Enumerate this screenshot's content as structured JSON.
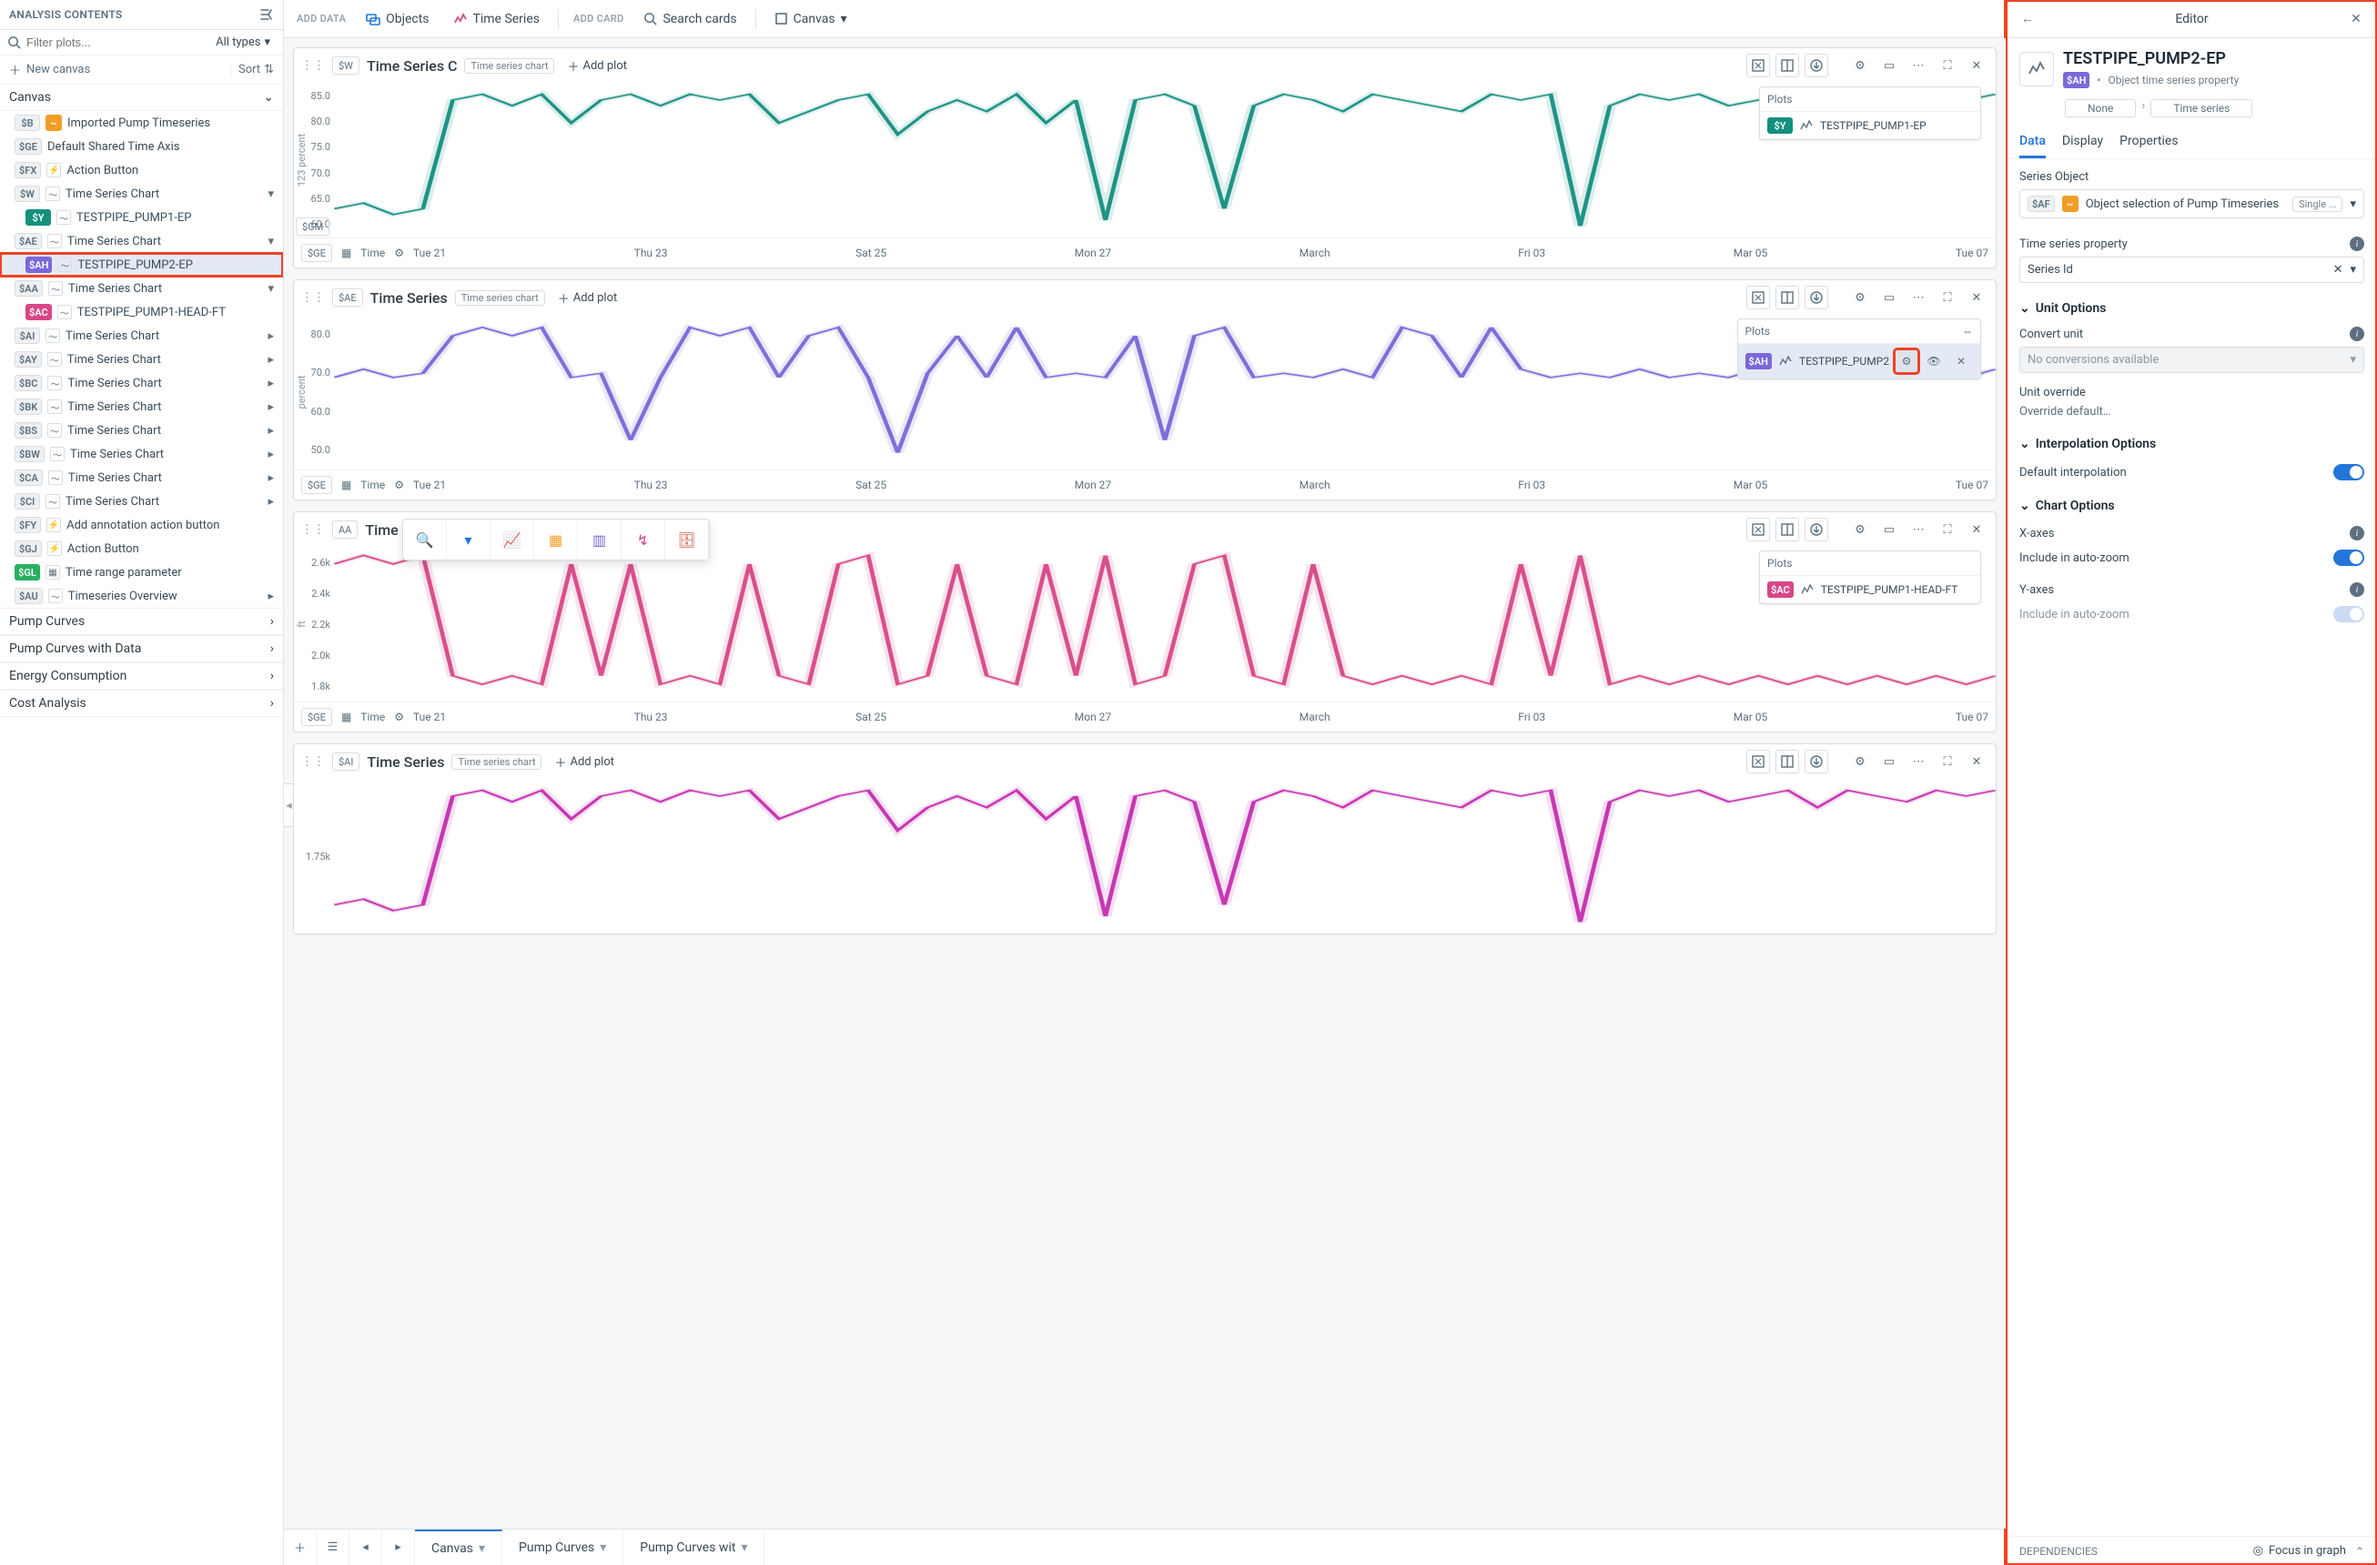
{
  "sidebar": {
    "header": "ANALYSIS CONTENTS",
    "filter_placeholder": "Filter plots...",
    "types_label": "All types",
    "new_canvas": "New canvas",
    "sort": "Sort",
    "canvas_section": "Canvas",
    "items": [
      {
        "tag": "$B",
        "tagStyle": "tag-gray",
        "icon": "orange",
        "label": "Imported Pump Timeseries",
        "chev": ""
      },
      {
        "tag": "$GE",
        "tagStyle": "tag-gray",
        "icon": "",
        "label": "Default Shared Time Axis",
        "chev": ""
      },
      {
        "tag": "$FX",
        "tagStyle": "tag-gray",
        "icon": "fx",
        "label": "Action Button",
        "chev": ""
      },
      {
        "tag": "$W",
        "tagStyle": "tag-gray",
        "icon": "chart",
        "label": "Time Series Chart",
        "chev": "▾"
      },
      {
        "tag": "$Y",
        "tagStyle": "tag-teal",
        "icon": "chart",
        "label": "TESTPIPE_PUMP1-EP",
        "chev": "",
        "indent": true
      },
      {
        "tag": "$AE",
        "tagStyle": "tag-gray",
        "icon": "chart",
        "label": "Time Series Chart",
        "chev": "▾"
      },
      {
        "tag": "$AH",
        "tagStyle": "tag-purple",
        "icon": "chart",
        "label": "TESTPIPE_PUMP2-EP",
        "chev": "",
        "indent": true,
        "selected": true,
        "boxed": true
      },
      {
        "tag": "$AA",
        "tagStyle": "tag-gray",
        "icon": "chart",
        "label": "Time Series Chart",
        "chev": "▾"
      },
      {
        "tag": "$AC",
        "tagStyle": "tag-pink",
        "icon": "chart",
        "label": "TESTPIPE_PUMP1-HEAD-FT",
        "chev": "",
        "indent": true
      },
      {
        "tag": "$AI",
        "tagStyle": "tag-gray",
        "icon": "chart",
        "label": "Time Series Chart",
        "chev": "▸"
      },
      {
        "tag": "$AY",
        "tagStyle": "tag-gray",
        "icon": "chart",
        "label": "Time Series Chart",
        "chev": "▸"
      },
      {
        "tag": "$BC",
        "tagStyle": "tag-gray",
        "icon": "chart",
        "label": "Time Series Chart",
        "chev": "▸"
      },
      {
        "tag": "$BK",
        "tagStyle": "tag-gray",
        "icon": "chart",
        "label": "Time Series Chart",
        "chev": "▸"
      },
      {
        "tag": "$BS",
        "tagStyle": "tag-gray",
        "icon": "chart",
        "label": "Time Series Chart",
        "chev": "▸"
      },
      {
        "tag": "$BW",
        "tagStyle": "tag-gray",
        "icon": "chart",
        "label": "Time Series Chart",
        "chev": "▸"
      },
      {
        "tag": "$CA",
        "tagStyle": "tag-gray",
        "icon": "chart",
        "label": "Time Series Chart",
        "chev": "▸"
      },
      {
        "tag": "$CI",
        "tagStyle": "tag-gray",
        "icon": "chart",
        "label": "Time Series Chart",
        "chev": "▸"
      },
      {
        "tag": "$FY",
        "tagStyle": "tag-gray",
        "icon": "fx",
        "label": "Add annotation action button",
        "chev": ""
      },
      {
        "tag": "$GJ",
        "tagStyle": "tag-gray",
        "icon": "fx",
        "label": "Action Button",
        "chev": ""
      },
      {
        "tag": "$GL",
        "tagStyle": "tag-green",
        "icon": "cal",
        "label": "Time range parameter",
        "chev": ""
      },
      {
        "tag": "$AU",
        "tagStyle": "tag-gray",
        "icon": "chart",
        "label": "Timeseries Overview",
        "chev": "▸"
      }
    ],
    "bottom": [
      "Pump Curves",
      "Pump Curves with Data",
      "Energy Consumption",
      "Cost Analysis"
    ]
  },
  "topbar": {
    "add_data": "ADD DATA",
    "objects": "Objects",
    "timeseries": "Time Series",
    "add_card": "ADD CARD",
    "search_cards": "Search cards",
    "canvas": "Canvas"
  },
  "cards": [
    {
      "drag": "⋮⋮",
      "chip": "$W",
      "title": "Time Series C",
      "pill": "Time series chart",
      "addplot": "Add plot",
      "ylabel": "123 percent",
      "yvar": "$GM",
      "yticks": [
        "85.0",
        "80.0",
        "75.0",
        "70.0",
        "65.0",
        "60.0"
      ],
      "plots_label": "Plots",
      "plot_tag": "$Y",
      "plot_tag_style": "tag-teal",
      "plot_name": "TESTPIPE_PUMP1-EP",
      "footer_chip": "$GE",
      "footer_label": "Time",
      "color": "#14907f"
    },
    {
      "drag": "⋮⋮",
      "chip": "$AE",
      "title": "Time Series",
      "pill": "Time series chart",
      "addplot": "Add plot",
      "ylabel": "percent",
      "yvar": "",
      "yticks": [
        "80.0",
        "70.0",
        "60.0",
        "50.0"
      ],
      "plots_label": "Plots",
      "plot_tag": "$AH",
      "plot_tag_style": "tag-purple",
      "plot_name": "TESTPIPE_PUMP2",
      "footer_chip": "$GE",
      "footer_label": "Time",
      "color": "#7b68d9",
      "selected": true,
      "gear_highlight": true,
      "show_icons": true
    },
    {
      "drag": "⋮⋮",
      "chip": "AA",
      "title": "Time Series",
      "pill": "",
      "addplot": "",
      "ylabel": "ft",
      "yvar": "",
      "yticks": [
        "2.6k",
        "2.4k",
        "2.2k",
        "2.0k",
        "1.8k"
      ],
      "plots_label": "Plots",
      "plot_tag": "$AC",
      "plot_tag_style": "tag-pink",
      "plot_name": "TESTPIPE_PUMP1-HEAD-FT",
      "footer_chip": "$GE",
      "footer_label": "Time",
      "color": "#d84787",
      "toolbar": true
    },
    {
      "drag": "⋮⋮",
      "chip": "$AI",
      "title": "Time Series",
      "pill": "Time series chart",
      "addplot": "Add plot",
      "ylabel": "",
      "yvar": "",
      "yticks": [
        "1.75k"
      ],
      "plots_label": "Plots",
      "plot_tag": "",
      "plot_tag_style": "",
      "plot_name": "",
      "footer_chip": "",
      "footer_label": "",
      "color": "#c52fb0",
      "partial": true
    }
  ],
  "xticks": [
    "Tue 21",
    "Thu 23",
    "Sat 25",
    "Mon 27",
    "March",
    "Fri 03",
    "Mar 05",
    "Tue 07"
  ],
  "bottom_tabs": [
    "Canvas",
    "Pump Curves",
    "Pump Curves wit"
  ],
  "editor": {
    "title": "Editor",
    "hero_title": "TESTPIPE_PUMP2-EP",
    "hero_tag": "$AH",
    "hero_sub": "Object time series property",
    "crumbs": [
      "None",
      "Time series"
    ],
    "tabs": [
      "Data",
      "Display",
      "Properties"
    ],
    "series_object_label": "Series Object",
    "series_chip": "$AF",
    "series_value": "Object selection of Pump Timeseries",
    "series_mode": "Single ...",
    "tsp_label": "Time series property",
    "tsp_value": "Series Id",
    "unit_section": "Unit Options",
    "convert_label": "Convert unit",
    "convert_value": "No conversions available",
    "override_label": "Unit override",
    "override_value": "Override default…",
    "interp_section": "Interpolation Options",
    "interp_label": "Default interpolation",
    "chart_section": "Chart Options",
    "xaxes": "X-axes",
    "incl_auto1": "Include in auto-zoom",
    "yaxes": "Y-axes",
    "incl_auto2": "Include in auto-zoom",
    "deps": "DEPENDENCIES",
    "focus": "Focus in graph"
  },
  "chart_data": [
    {
      "type": "line",
      "title": "TESTPIPE_PUMP1-EP",
      "ylabel": "percent",
      "ylim": [
        60,
        87
      ],
      "series": [
        {
          "name": "TESTPIPE_PUMP1-EP",
          "color": "#14907f",
          "values": [
            65,
            66,
            64,
            65,
            84,
            85,
            83,
            85,
            80,
            84,
            85,
            83,
            85,
            84,
            85,
            80,
            82,
            84,
            85,
            78,
            82,
            84,
            82,
            85,
            80,
            84,
            63,
            84,
            85,
            83,
            65,
            83,
            85,
            84,
            82,
            85,
            84,
            83,
            82,
            85,
            84,
            85,
            62,
            83,
            85,
            84,
            85,
            83,
            84,
            85,
            82,
            85,
            84,
            83,
            85,
            84,
            85
          ]
        }
      ]
    },
    {
      "type": "line",
      "title": "TESTPIPE_PUMP2-EP",
      "ylabel": "percent",
      "ylim": [
        48,
        85
      ],
      "series": [
        {
          "name": "TESTPIPE_PUMP2-EP",
          "color": "#7b68d9",
          "values": [
            70,
            72,
            70,
            71,
            80,
            82,
            80,
            82,
            70,
            71,
            55,
            70,
            82,
            80,
            82,
            70,
            80,
            82,
            70,
            52,
            71,
            80,
            70,
            82,
            70,
            71,
            70,
            80,
            55,
            80,
            82,
            70,
            71,
            70,
            72,
            70,
            82,
            80,
            70,
            82,
            72,
            70,
            71,
            70,
            72,
            70,
            71,
            70,
            72,
            70,
            71,
            70,
            72,
            70,
            71,
            70,
            72
          ]
        }
      ]
    },
    {
      "type": "line",
      "title": "TESTPIPE_PUMP1-HEAD-FT",
      "ylabel": "ft",
      "ylim": [
        1750,
        2650
      ],
      "series": [
        {
          "name": "TESTPIPE_PUMP1-HEAD-FT",
          "color": "#d84787",
          "values": [
            2550,
            2600,
            2550,
            2600,
            1900,
            1850,
            1900,
            1850,
            2550,
            1900,
            2550,
            1850,
            1900,
            1850,
            2550,
            1900,
            1850,
            2550,
            2600,
            1850,
            1900,
            2550,
            1900,
            1850,
            2550,
            1900,
            2600,
            1850,
            1900,
            2550,
            2600,
            1900,
            1850,
            2550,
            1900,
            1850,
            1900,
            1850,
            1900,
            1850,
            2550,
            1900,
            2600,
            1850,
            1900,
            1850,
            1900,
            1850,
            1900,
            1850,
            1900,
            1850,
            1900,
            1850,
            1900,
            1850,
            1900
          ]
        }
      ]
    }
  ]
}
